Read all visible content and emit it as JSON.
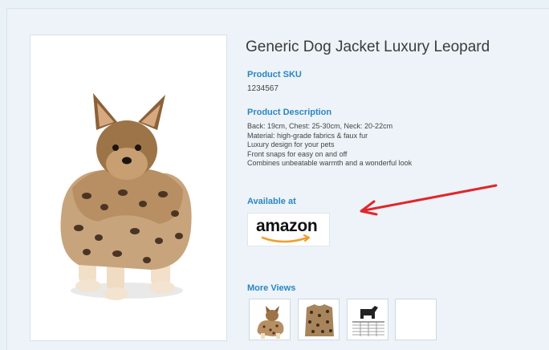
{
  "product": {
    "title": "Generic Dog Jacket Luxury Leopard",
    "sku_label": "Product SKU",
    "sku_value": "1234567",
    "description_label": "Product Description",
    "description_lines": [
      "Back: 19cm, Chest: 25-30cm, Neck: 20-22cm",
      "Material: high-grade fabrics & faux fur",
      "Luxury design for your pets",
      "Front snaps for easy on and off",
      "Combines unbeatable warmth and a wonderful look"
    ],
    "available_label": "Available at",
    "retailer": "amazon",
    "more_views_label": "More Views"
  },
  "colors": {
    "label_blue": "#2a86c4",
    "arrow_red": "#e0262b",
    "amazon_smile": "#f19e2c"
  },
  "thumbnails": [
    {
      "name": "thumb-dog-in-jacket"
    },
    {
      "name": "thumb-jacket-fabric"
    },
    {
      "name": "thumb-size-chart"
    },
    {
      "name": "thumb-empty"
    }
  ]
}
